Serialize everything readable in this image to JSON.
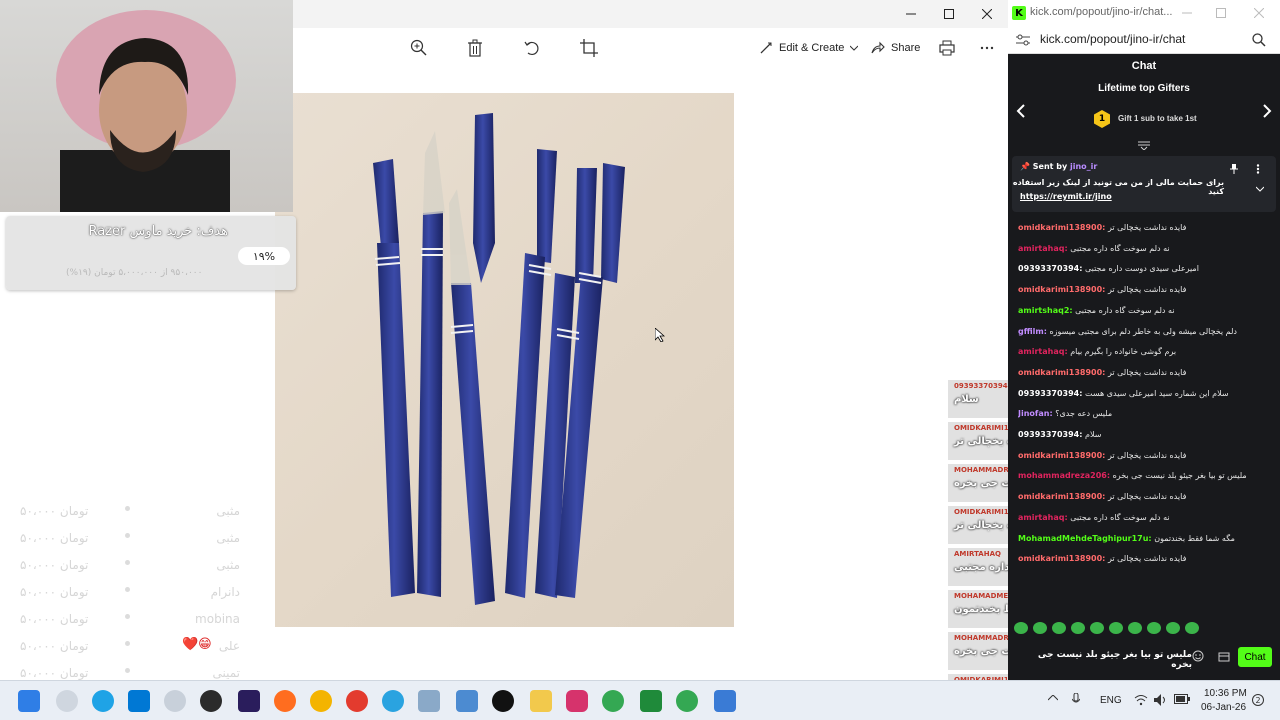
{
  "viewer": {
    "toolbar": {
      "edit_create_label": "Edit & Create",
      "share_label": "Share"
    }
  },
  "goal": {
    "title": "هدف: خرید ماوس Razer",
    "percent_label": "۱۹%",
    "progress_fraction": 0.19,
    "subtitle": "۹۵۰،۰۰۰ از ۵،۰۰۰،۰۰۰ تومان (۱۹%)"
  },
  "donors": [
    {
      "amount": "۵۰،۰۰۰ تومان",
      "name": "مثبی"
    },
    {
      "amount": "۵۰،۰۰۰ تومان",
      "name": "مثبی"
    },
    {
      "amount": "۵۰،۰۰۰ تومان",
      "name": "مثبی"
    },
    {
      "amount": "۵۰،۰۰۰ تومان",
      "name": "دانرام"
    },
    {
      "amount": "۵۰،۰۰۰ تومان",
      "name": "mobina"
    },
    {
      "amount": "۵۰،۰۰۰ تومان",
      "name": "علی"
    },
    {
      "amount": "۵۰،۰۰۰ تومان",
      "name": "تمینی"
    }
  ],
  "overlay": [
    {
      "name": "09393370394",
      "text": "سلام"
    },
    {
      "name": "OMIDKARIMI138900",
      "text": "فایده نداشت یخچالی تر"
    },
    {
      "name": "MOHAMMADREZA206",
      "text": "ملیس تو بیا بغر جیئو بلد نیست جی بخره"
    },
    {
      "name": "OMIDKARIMI138900",
      "text": "فایده نداشت یخچالی تر"
    },
    {
      "name": "AMIRTAHAQ",
      "text": "نه دلم سوخت گاه داره مجتبی"
    },
    {
      "name": "MOHAMADMEHDETAGHIPUR17U",
      "text": "مگه شما فقط بخندتمون"
    },
    {
      "name": "MOHAMMADREZA206",
      "text": "ملیس تو بیا بغر جیئو بلد نیست جی بخره"
    },
    {
      "name": "OMIDKARIMI138900",
      "text": "فایده نداشت یخچالی تر"
    }
  ],
  "chat": {
    "tab_title": "kick.com/popout/jino-ir/chat...",
    "address": "kick.com/popout/jino-ir/chat",
    "header": "Chat",
    "gifters_title": "Lifetime top Gifters",
    "gift_rank": "1",
    "gift_text": "Gift 1 sub to take 1st",
    "pinned": {
      "sent_by_label": "Sent by",
      "user": "jino_ir",
      "text": "برای حمایت مالی از من می تونید از لینک زیر استفاده کنید",
      "link": "https://reymit.ir/jino"
    },
    "messages": [
      {
        "user": "omidkarimi138900:",
        "text": "فایده نداشت یخچالی تر",
        "color": "#ff6b6b"
      },
      {
        "user": "amirtahaq:",
        "text": "نه دلم سوخت گاه داره مجتبی",
        "color": "#e0245e"
      },
      {
        "user": "09393370394:",
        "text": "امیرعلی سیدی دوست داره مجتبی",
        "color": "#ffffff"
      },
      {
        "user": "omidkarimi138900:",
        "text": "فایده نداشت یخچالی تر",
        "color": "#ff6b6b"
      },
      {
        "user": "amirtshaq2:",
        "text": "نه دلم سوخت گاه داره مجتبی",
        "color": "#53fc18"
      },
      {
        "user": "gffilm:",
        "text": "دلم یخچالی میشه ولی به خاطر دلم برای مجتبی میسوزه",
        "color": "#c18cff"
      },
      {
        "user": "amirtahaq:",
        "text": "برم گوشی خانواده را بگیرم بیام",
        "color": "#e0245e"
      },
      {
        "user": "omidkarimi138900:",
        "text": "فایده نداشت یخچالی تر",
        "color": "#ff6b6b"
      },
      {
        "user": "09393370394:",
        "text": "سلام این شماره سید امیرعلی سیدی هست",
        "color": "#ffffff"
      },
      {
        "user": "Jinofan:",
        "text": "ملیس دعه جدی؟",
        "color": "#c18cff"
      },
      {
        "user": "09393370394:",
        "text": "سلام",
        "color": "#ffffff"
      },
      {
        "user": "omidkarimi138900:",
        "text": "فایده نداشت یخچالی تر",
        "color": "#ff6b6b"
      },
      {
        "user": "mohammadreza206:",
        "text": "ملیس تو بیا بغر جیئو بلد نیست جی بخره",
        "color": "#e0245e"
      },
      {
        "user": "omidkarimi138900:",
        "text": "فایده نداشت یخچالی تر",
        "color": "#ff6b6b"
      },
      {
        "user": "amirtahaq:",
        "text": "نه دلم سوخت گاه داره مجتبی",
        "color": "#e0245e"
      },
      {
        "user": "MohamadMehdeTaghipur17u:",
        "text": "مگه شما فقط بخندتمون",
        "color": "#53fc18"
      },
      {
        "user": "omidkarimi138900:",
        "text": "فایده نداشت یخچالی تر",
        "color": "#ff6b6b"
      }
    ],
    "input_value": "ملیس تو بیا بغر جیئو بلد نیست جی بخره",
    "send_label": "Chat"
  },
  "taskbar": {
    "language": "ENG",
    "time": "10:36 PM",
    "date": "06-Jan-26"
  }
}
